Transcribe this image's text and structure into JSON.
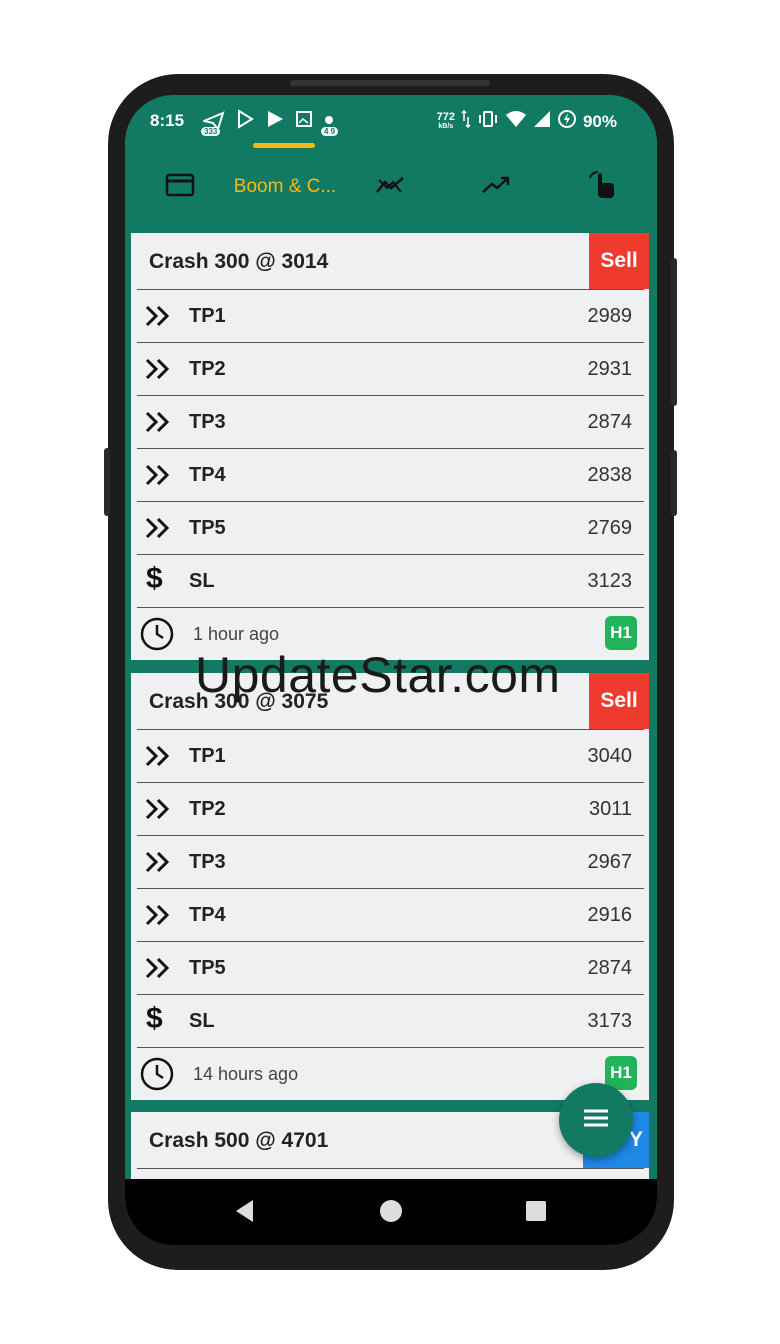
{
  "status_bar": {
    "time": "8:15",
    "notif_count_1": "333",
    "notif_count_2": "4 9",
    "net_speed": "772",
    "net_unit": "kB/s",
    "battery": "90%"
  },
  "tabs": [
    {
      "icon": "card-icon",
      "label": ""
    },
    {
      "icon": "",
      "label": "Boom & C..."
    },
    {
      "icon": "trend-cross-icon",
      "label": ""
    },
    {
      "icon": "trending-up-icon",
      "label": ""
    },
    {
      "icon": "tap-icon",
      "label": ""
    }
  ],
  "signals": [
    {
      "title": "Crash 300 @ 3014",
      "action": "Sell",
      "rows": [
        {
          "icon": "double-chevron-icon",
          "label": "TP1",
          "value": "2989"
        },
        {
          "icon": "double-chevron-icon",
          "label": "TP2",
          "value": "2931"
        },
        {
          "icon": "double-chevron-icon",
          "label": "TP3",
          "value": "2874"
        },
        {
          "icon": "double-chevron-icon",
          "label": "TP4",
          "value": "2838"
        },
        {
          "icon": "double-chevron-icon",
          "label": "TP5",
          "value": "2769"
        },
        {
          "icon": "dollar-icon",
          "label": "SL",
          "value": "3123"
        }
      ],
      "time_ago": "1 hour ago",
      "timeframe": "H1"
    },
    {
      "title": "Crash 300 @ 3075",
      "action": "Sell",
      "rows": [
        {
          "icon": "double-chevron-icon",
          "label": "TP1",
          "value": "3040"
        },
        {
          "icon": "double-chevron-icon",
          "label": "TP2",
          "value": "3011"
        },
        {
          "icon": "double-chevron-icon",
          "label": "TP3",
          "value": "2967"
        },
        {
          "icon": "double-chevron-icon",
          "label": "TP4",
          "value": "2916"
        },
        {
          "icon": "double-chevron-icon",
          "label": "TP5",
          "value": "2874"
        },
        {
          "icon": "dollar-icon",
          "label": "SL",
          "value": "3173"
        }
      ],
      "time_ago": "14 hours ago",
      "timeframe": "H1"
    },
    {
      "title": "Crash 500 @ 4701",
      "action": "Y"
    }
  ],
  "watermark": "UpdateStar.com",
  "colors": {
    "primary": "#127a63",
    "accent": "#f5b913",
    "sell": "#ef3b2d",
    "buy": "#1e88e5",
    "timeframe_badge": "#20b35a"
  }
}
